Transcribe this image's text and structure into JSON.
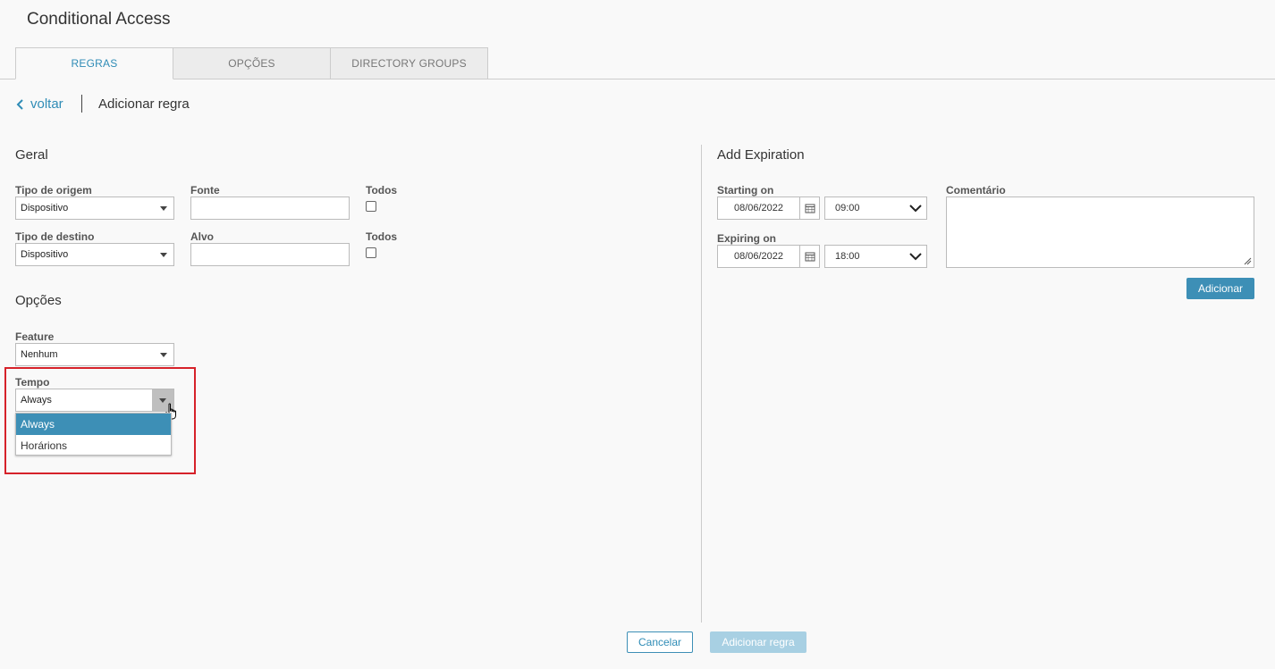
{
  "app": {
    "title": "Conditional Access"
  },
  "tabs": [
    {
      "label": "REGRAS",
      "active": true
    },
    {
      "label": "OPÇÕES",
      "active": false
    },
    {
      "label": "DIRECTORY GROUPS",
      "active": false
    }
  ],
  "breadcrumb": {
    "back_label": "voltar",
    "page_title": "Adicionar regra"
  },
  "geral": {
    "title": "Geral",
    "tipo_origem": {
      "label": "Tipo de origem",
      "value": "Dispositivo"
    },
    "fonte": {
      "label": "Fonte",
      "value": ""
    },
    "todos_1": {
      "label": "Todos",
      "checked": false
    },
    "tipo_destino": {
      "label": "Tipo de destino",
      "value": "Dispositivo"
    },
    "alvo": {
      "label": "Alvo",
      "value": ""
    },
    "todos_2": {
      "label": "Todos",
      "checked": false
    }
  },
  "opcoes": {
    "title": "Opções",
    "feature": {
      "label": "Feature",
      "value": "Nenhum"
    },
    "tempo": {
      "label": "Tempo",
      "value": "Always",
      "options": [
        {
          "label": "Always",
          "selected": true
        },
        {
          "label": "Horárions",
          "selected": false
        }
      ]
    }
  },
  "expiration": {
    "title": "Add Expiration",
    "starting": {
      "label": "Starting on",
      "date": "08/06/2022",
      "time": "09:00"
    },
    "expiring": {
      "label": "Expiring on",
      "date": "08/06/2022",
      "time": "18:00"
    },
    "comment": {
      "label": "Comentário",
      "value": ""
    },
    "add_button": "Adicionar"
  },
  "footer": {
    "cancel": "Cancelar",
    "submit": "Adicionar regra"
  },
  "colors": {
    "accent": "#3d8fb6",
    "highlight": "#d6222a",
    "link": "#2f8cb6"
  }
}
